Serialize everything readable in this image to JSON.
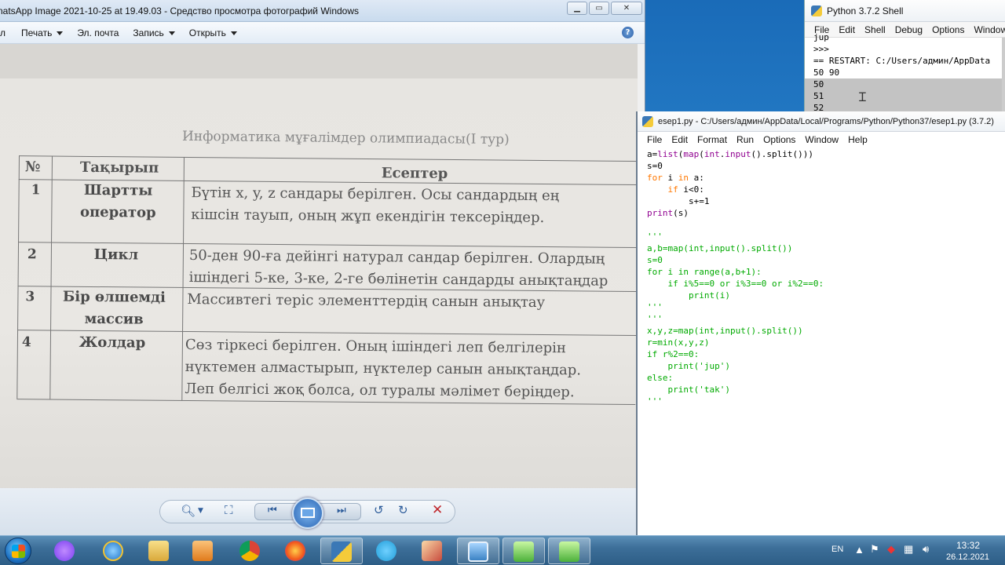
{
  "viewer": {
    "title": "natsApp Image 2021-10-25 at 19.49.03 - Средство просмотра фотографий Windows",
    "menu": {
      "file": "л",
      "print": "Печать",
      "email": "Эл. почта",
      "burn": "Запись",
      "open": "Открыть"
    },
    "help": "?",
    "photo": {
      "title": "Информатика мұғалімдер олимпиадасы(I тур)",
      "header": {
        "num": "№",
        "topic": "Тақырып",
        "tasks": "Есептер"
      },
      "rows": [
        {
          "num": "1",
          "topic1": "Шартты",
          "topic2": "оператор",
          "task1": "Бүтін x, y, z сандары берілген. Осы сандардың ең",
          "task2": "кішсін тауып, оның жұп екендігін тексеріңдер.",
          "task3": ""
        },
        {
          "num": "2",
          "topic1": "Цикл",
          "topic2": "",
          "task1": "50-ден 90-ға дейінгі натурал сандар берілген. Олардың",
          "task2": "ішіндегі 5-ке, 3-ке, 2-ге бөлінетін сандарды анықтаңдар",
          "task3": ""
        },
        {
          "num": "3",
          "topic1": "Бір өлшемді",
          "topic2": "массив",
          "task1": "Массивтегі теріс элементтердің санын анықтау",
          "task2": "",
          "task3": ""
        },
        {
          "num": "4",
          "topic1": "Жолдар",
          "topic2": "",
          "task1": "Сөз тіркесі берілген. Оның ішіндегі леп белгілерін",
          "task2": "нүктемен алмастырып, нүктелер санын анықтаңдар.",
          "task3": "Леп белгісі жоқ болса, ол туралы мәлімет беріңдер."
        }
      ]
    }
  },
  "shell": {
    "title": "Python 3.7.2 Shell",
    "menu": [
      "File",
      "Edit",
      "Shell",
      "Debug",
      "Options",
      "Window"
    ],
    "lines": [
      "jup",
      ">>>",
      "== RESTART: C:/Users/админ/AppData",
      "50 90",
      "50",
      "51",
      "52"
    ]
  },
  "editor": {
    "title": "esep1.py - C:/Users/админ/AppData/Local/Programs/Python/Python37/esep1.py (3.7.2)",
    "menu": [
      "File",
      "Edit",
      "Format",
      "Run",
      "Options",
      "Window",
      "Help"
    ]
  },
  "taskbar": {
    "lang": "EN",
    "time": "13:32",
    "date": "26.12.2021"
  },
  "colors": {
    "keyword": "#ff7700",
    "builtin": "#900090",
    "string_comment": "#00aa00",
    "taskbar": "#3d6f99"
  }
}
